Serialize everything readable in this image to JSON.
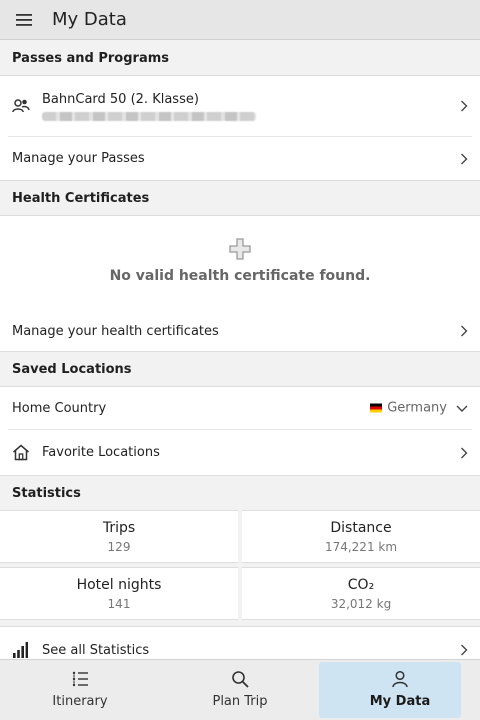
{
  "header": {
    "title": "My Data"
  },
  "passes": {
    "heading": "Passes and Programs",
    "card_title": "BahnCard 50 (2. Klasse)",
    "manage_label": "Manage your Passes"
  },
  "health": {
    "heading": "Health Certificates",
    "empty_message": "No valid health certificate found.",
    "manage_label": "Manage your health certificates"
  },
  "locations": {
    "heading": "Saved Locations",
    "home_label": "Home Country",
    "home_value": "Germany",
    "favorites_label": "Favorite Locations"
  },
  "statistics": {
    "heading": "Statistics",
    "items": [
      {
        "label": "Trips",
        "value": "129"
      },
      {
        "label": "Distance",
        "value": "174,221 km"
      },
      {
        "label": "Hotel nights",
        "value": "141"
      },
      {
        "label": "CO₂",
        "value": "32,012 kg"
      }
    ],
    "see_all_label": "See all Statistics"
  },
  "nav": {
    "items": [
      {
        "label": "Itinerary",
        "icon": "list-icon",
        "active": false
      },
      {
        "label": "Plan Trip",
        "icon": "search-icon",
        "active": false
      },
      {
        "label": "My Data",
        "icon": "person-icon",
        "active": true
      }
    ]
  },
  "colors": {
    "active_tab_bg": "#cfe4f2",
    "header_bg": "#e6e6e6",
    "flag": [
      "#000000",
      "#dd0000",
      "#ffce00"
    ]
  }
}
